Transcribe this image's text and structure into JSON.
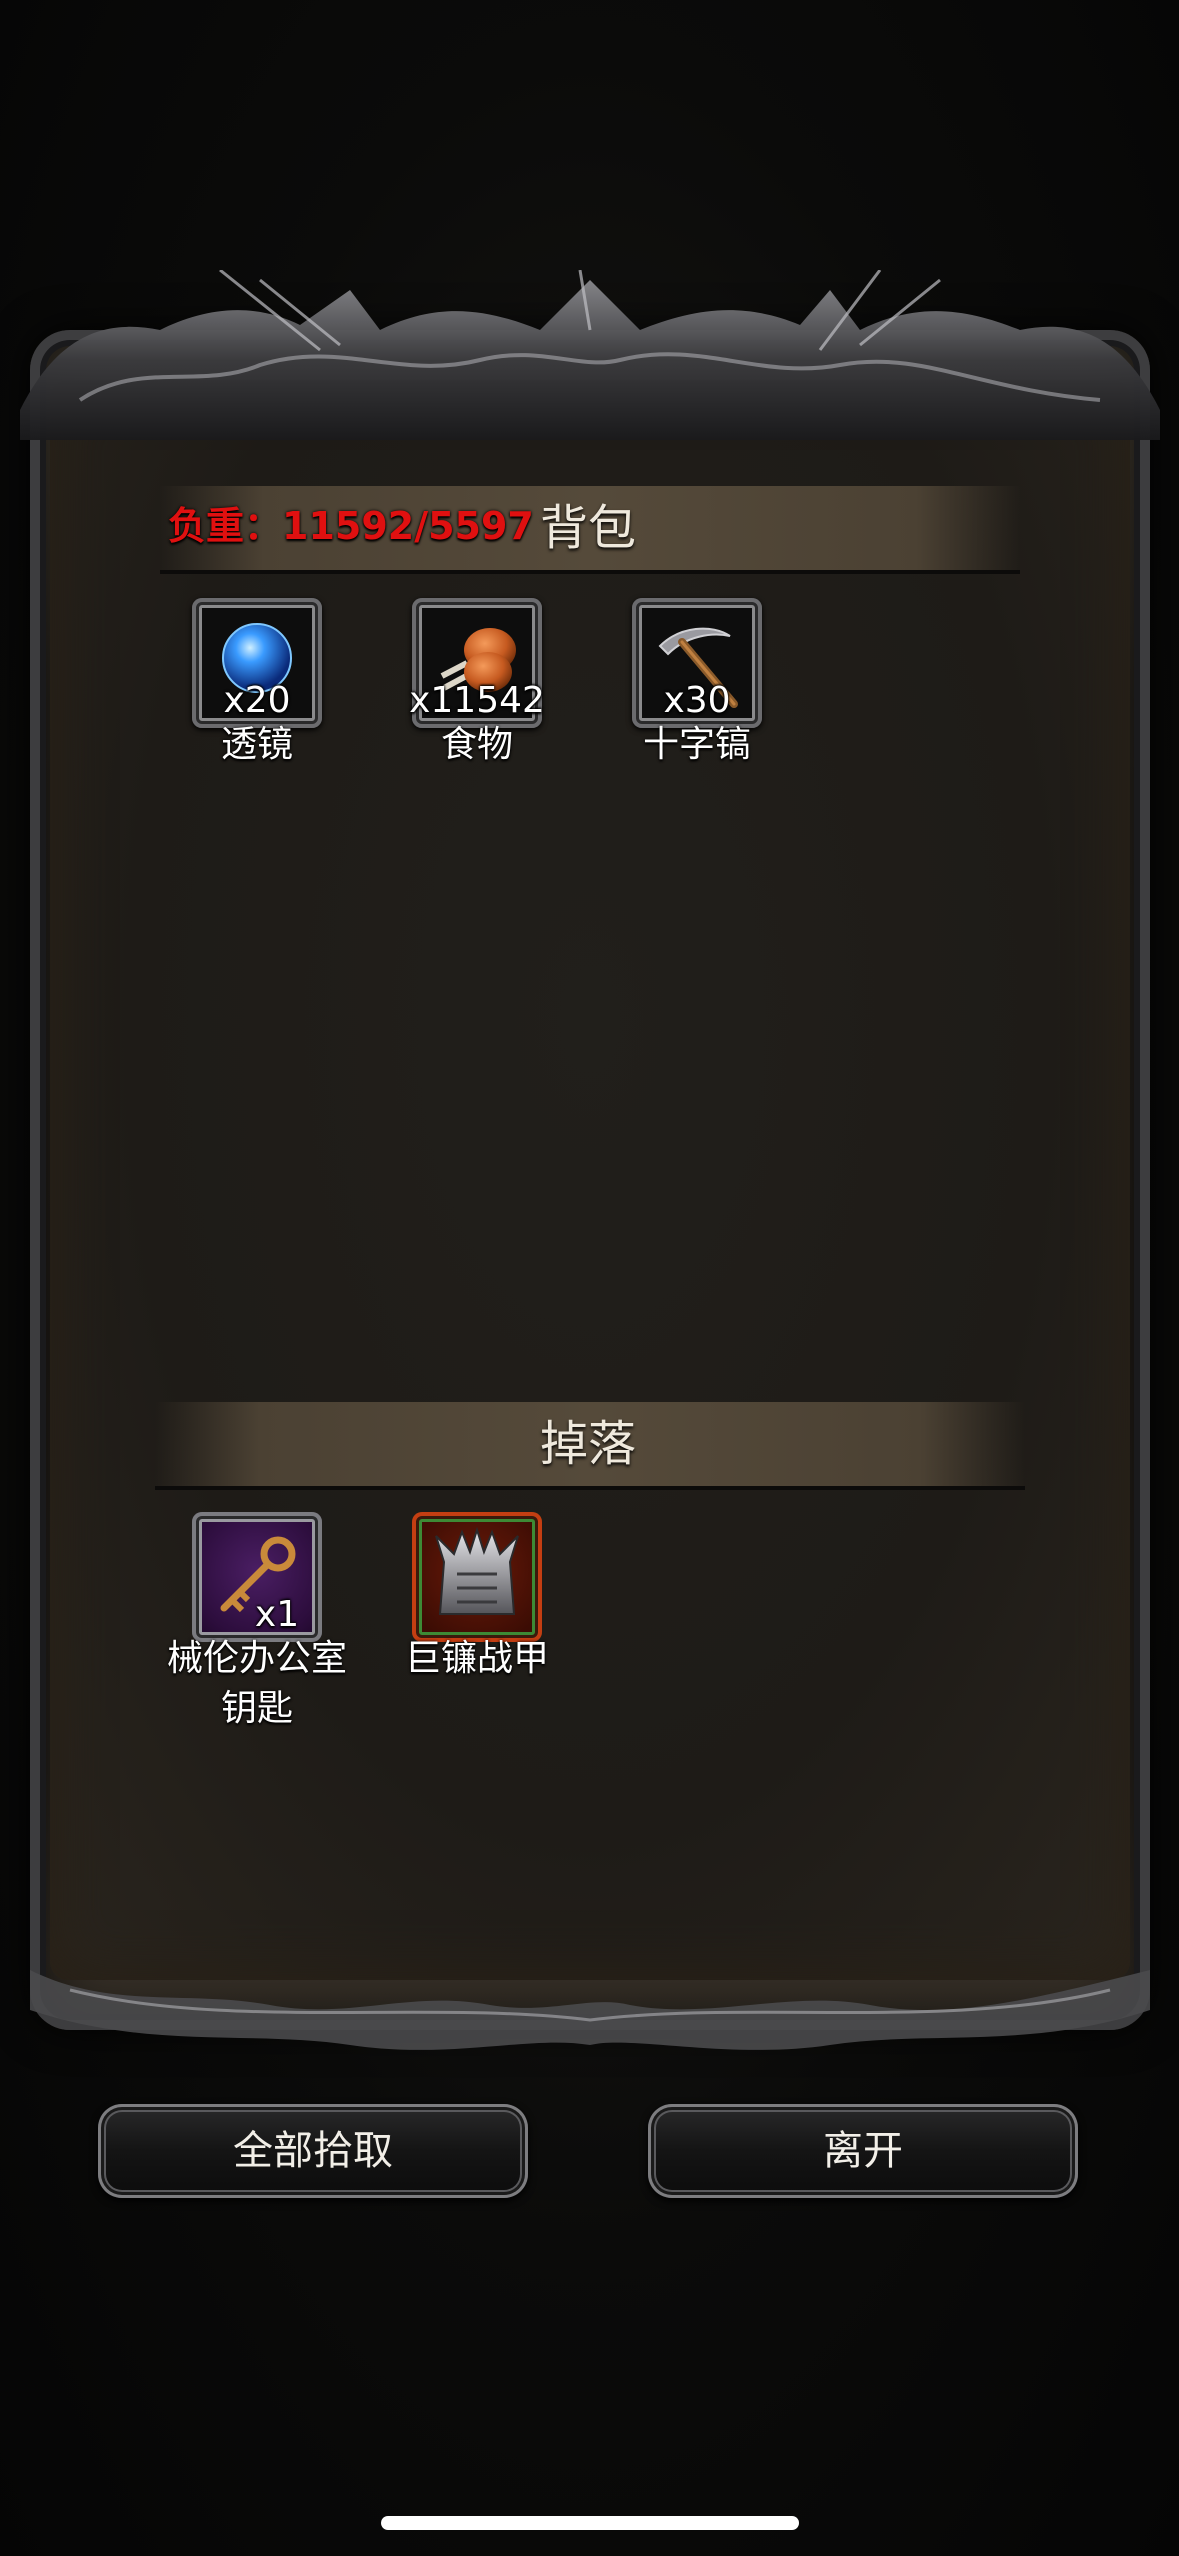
{
  "inventory": {
    "title": "背包",
    "weight_text": "负重：11592/5597",
    "items": [
      {
        "name": "透镜",
        "count": "x20",
        "icon": "blue-orb-lens-icon"
      },
      {
        "name": "食物",
        "count": "x11542",
        "icon": "roast-meat-food-icon"
      },
      {
        "name": "十字镐",
        "count": "x30",
        "icon": "pickaxe-icon"
      }
    ]
  },
  "drops": {
    "title": "掉落",
    "items": [
      {
        "name_line1": "械伦办公室",
        "name_line2": "钥匙",
        "count": "x1",
        "icon": "bronze-key-icon",
        "rarity_color": "#4a1e63"
      },
      {
        "name_line1": "巨镰战甲",
        "count": "",
        "icon": "spiked-armor-icon",
        "rarity_color": "#c43e12"
      }
    ]
  },
  "buttons": {
    "pick_all": "全部拾取",
    "leave": "离开"
  },
  "colors": {
    "weight_over_limit": "#e01010"
  }
}
